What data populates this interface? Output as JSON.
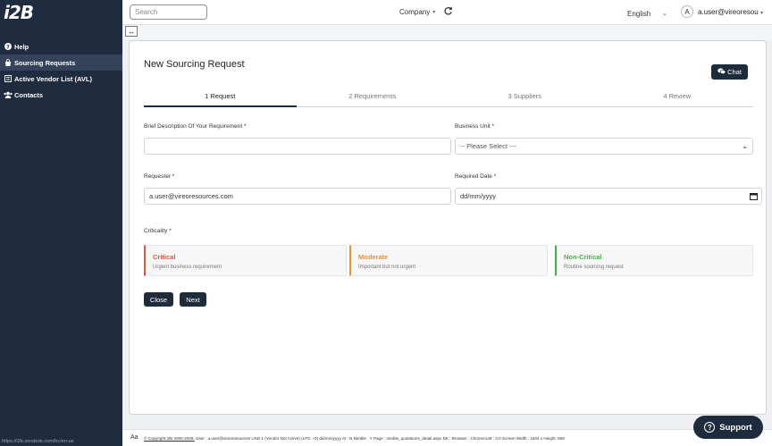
{
  "brand": {
    "logo_text": "i2B"
  },
  "sidebar": {
    "items": [
      {
        "label": "Help",
        "icon": "question-circle-icon"
      },
      {
        "label": "Sourcing Requests",
        "icon": "shopping-bag-icon",
        "active": true
      },
      {
        "label": "Active Vendor List (AVL)",
        "icon": "list-icon"
      },
      {
        "label": "Contacts",
        "icon": "users-icon"
      }
    ],
    "status_url": "https://i2b.zendesk.com/hc/en-us"
  },
  "topbar": {
    "search_placeholder": "Search",
    "company_label": "Company",
    "language": "English",
    "avatar_letter": "A",
    "user": "a.user@vireoresou"
  },
  "form": {
    "title": "New Sourcing Request",
    "chat_label": "Chat",
    "steps": [
      "1 Request",
      "2 Requirements",
      "3 Suppliers",
      "4 Review"
    ],
    "active_step": 0,
    "description_label": "Brief Description Of Your Requirement *",
    "description_value": "",
    "business_unit_label": "Business Unit *",
    "business_unit_value": "-- Please Select ---",
    "requester_label": "Requester *",
    "requester_value": "a.user@vireoresources.com",
    "required_date_label": "Required Date *",
    "required_date_value": "dd/mm/yyyy",
    "criticality_label": "Criticality *",
    "criticality": [
      {
        "title": "Critical",
        "subtitle": "Urgent business requirement",
        "color": "#e0533c"
      },
      {
        "title": "Moderate",
        "subtitle": "Important but not urgent",
        "color": "#e8913a"
      },
      {
        "title": "Non-Critical",
        "subtitle": "Routine sourcing request",
        "color": "#4caf50"
      }
    ],
    "close_label": "Close",
    "next_label": "Next"
  },
  "footer": {
    "aa": "Aa",
    "copyright": "© Copyright i2B 2000-2026.",
    "info": "User : a.user@vireoresources USD 1 (Vendor Not Active) (UTC +0) dd/mm/yyyy AI : N Nimble : Y Page : nimble_quotations_detail.aspx DK : Browser : Chrome149 : 3.0 Screen Width : 1504 x Height :860"
  },
  "support_label": "Support"
}
